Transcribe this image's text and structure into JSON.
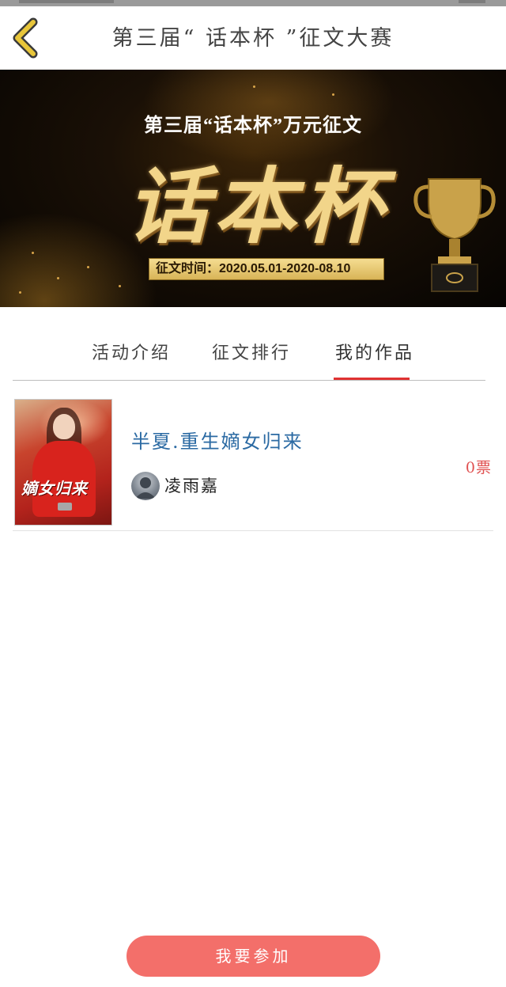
{
  "header": {
    "title": "第三届“ 话本杯 ”征文大赛",
    "back_icon": "chevron-left-icon",
    "back_icon_color": "#e8c63a"
  },
  "banner": {
    "subtitle": "第三届“话本杯”万元征文",
    "headline": "话本杯",
    "dates": "征文时间：2020.05.01-2020-08.10",
    "trophy_icon": "trophy-icon"
  },
  "tabs": {
    "items": [
      {
        "label": "活动介绍"
      },
      {
        "label": "征文排行"
      },
      {
        "label": "我的作品"
      }
    ],
    "active_color": "#e03232"
  },
  "works": [
    {
      "title": "半夏.重生嫡女归来",
      "author": "凌雨嘉",
      "votes": "0票",
      "cover_text": "嫡女归来"
    }
  ],
  "actions": {
    "join_label": "我要参加",
    "join_color": "#f36f6a"
  }
}
